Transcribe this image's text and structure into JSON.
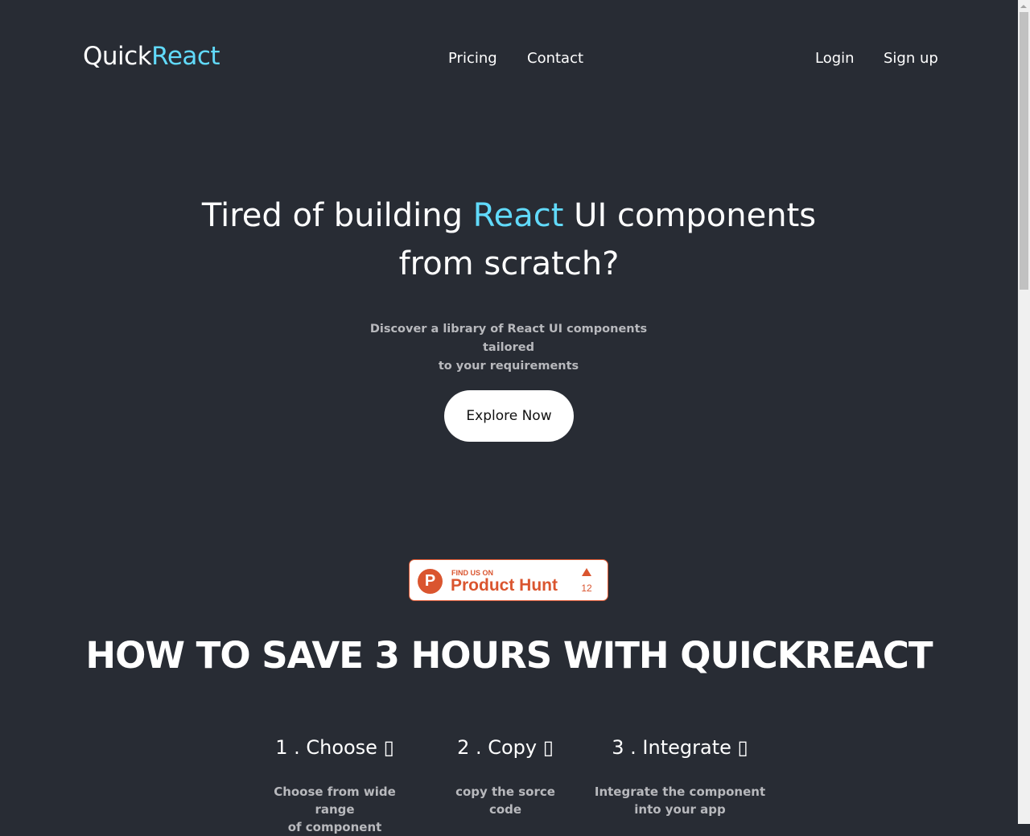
{
  "header": {
    "logo_part1": "Quick",
    "logo_part2": "React",
    "nav": [
      {
        "label": "Pricing"
      },
      {
        "label": "Contact"
      }
    ],
    "auth": {
      "login": "Login",
      "signup": "Sign up"
    }
  },
  "hero": {
    "title_before": "Tired of building ",
    "title_accent": "React",
    "title_after": " UI components",
    "title_line2": "from scratch?",
    "subtitle_line1": "Discover a library of React UI components tailored",
    "subtitle_line2": "to your requirements",
    "cta_label": "Explore Now"
  },
  "product_hunt": {
    "logo_letter": "P",
    "find_us": "FIND US ON",
    "name": "Product Hunt",
    "upvotes": "12"
  },
  "how_to": {
    "title": "HOW TO SAVE 3 HOURS WITH QUICKREACT",
    "steps": [
      {
        "title": "1 . Choose ▯",
        "desc_line1": "Choose from wide range",
        "desc_line2": "of component"
      },
      {
        "title": "2 . Copy ▯",
        "desc_line1": "copy the sorce",
        "desc_line2": "code"
      },
      {
        "title": "3 . Integrate ▯",
        "desc_line1": "Integrate the component",
        "desc_line2": "into your app"
      }
    ]
  },
  "colors": {
    "background": "#282c34",
    "accent": "#61dafb",
    "product_hunt": "#da552f"
  }
}
